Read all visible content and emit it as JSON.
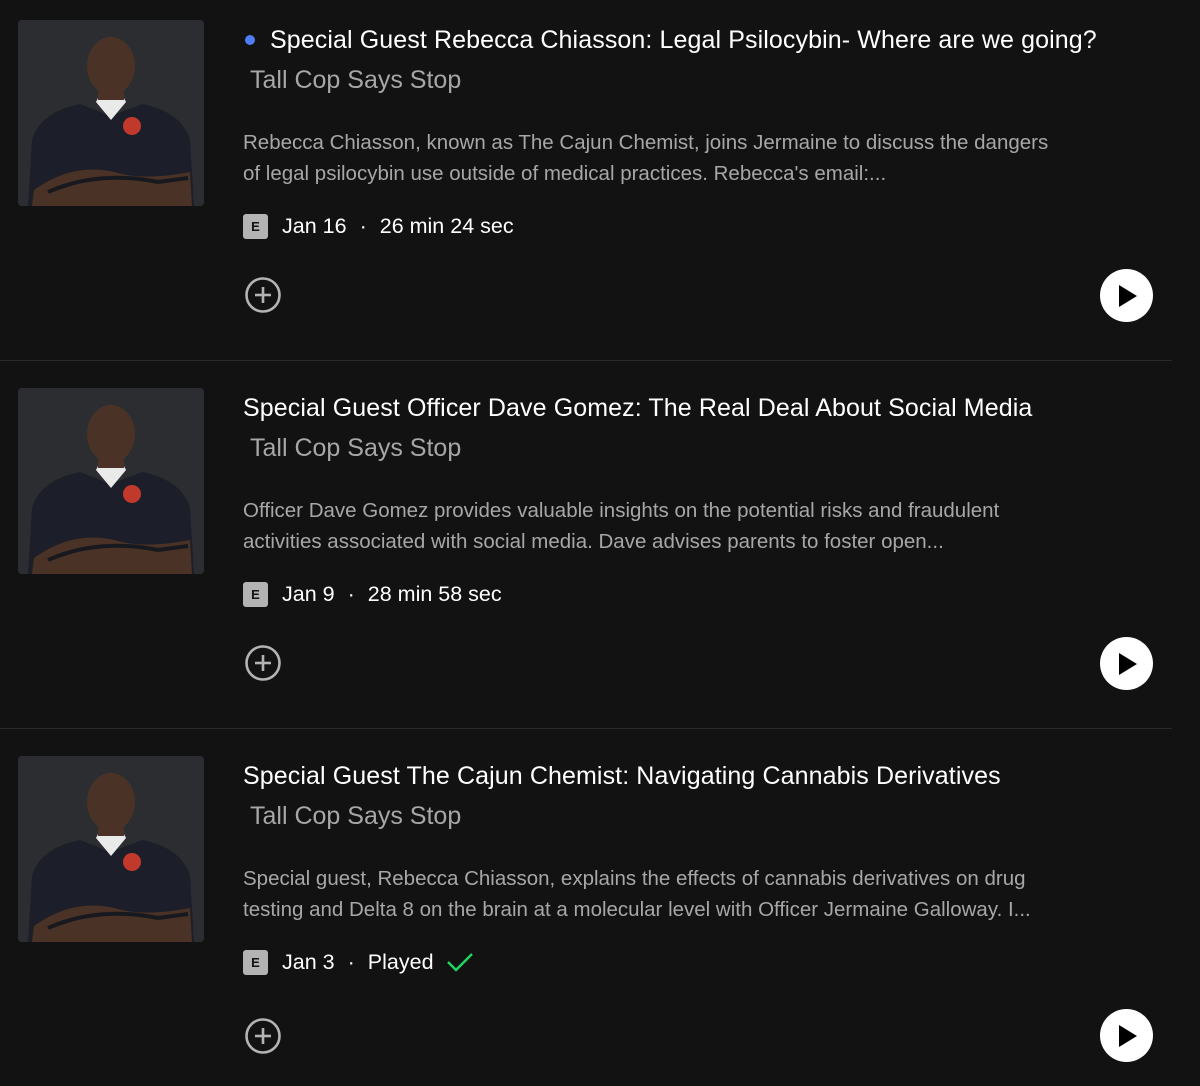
{
  "episodes": [
    {
      "is_new": true,
      "title": "Special Guest Rebecca Chiasson: Legal Psilocybin- Where are we going?",
      "show": "Tall Cop Says Stop",
      "description_line1": "Rebecca Chiasson, known as The Cajun Chemist, joins Jermaine to discuss the dangers",
      "description_line2": "of legal psilocybin use outside of medical practices. Rebecca's email:...",
      "explicit_badge": "E",
      "date": "Jan 16",
      "separator": "·",
      "duration": "26 min 24 sec",
      "played": false
    },
    {
      "is_new": false,
      "title": "Special Guest Officer Dave Gomez: The Real Deal About Social Media",
      "show": "Tall Cop Says Stop",
      "description_line1": "Officer Dave Gomez provides valuable insights on the potential risks and fraudulent",
      "description_line2": "activities associated with social media. Dave advises parents to foster open...",
      "explicit_badge": "E",
      "date": "Jan 9",
      "separator": "·",
      "duration": "28 min 58 sec",
      "played": false
    },
    {
      "is_new": false,
      "title": "Special Guest The Cajun Chemist: Navigating Cannabis Derivatives",
      "show": "Tall Cop Says Stop",
      "description_line1": "Special guest, Rebecca Chiasson, explains the effects of cannabis derivatives on drug",
      "description_line2": "testing and Delta 8 on the brain at a molecular level with Officer Jermaine Galloway. I...",
      "explicit_badge": "E",
      "date": "Jan 3",
      "separator": "·",
      "duration": "Played",
      "played": true
    }
  ],
  "colors": {
    "background": "#121212",
    "new_dot": "#4f7cf1",
    "played_check": "#1ed760",
    "secondary_text": "#a7a7a7"
  },
  "icons": {
    "add": "plus-circle-icon",
    "play": "play-icon",
    "played": "check-icon",
    "explicit": "explicit-badge"
  }
}
